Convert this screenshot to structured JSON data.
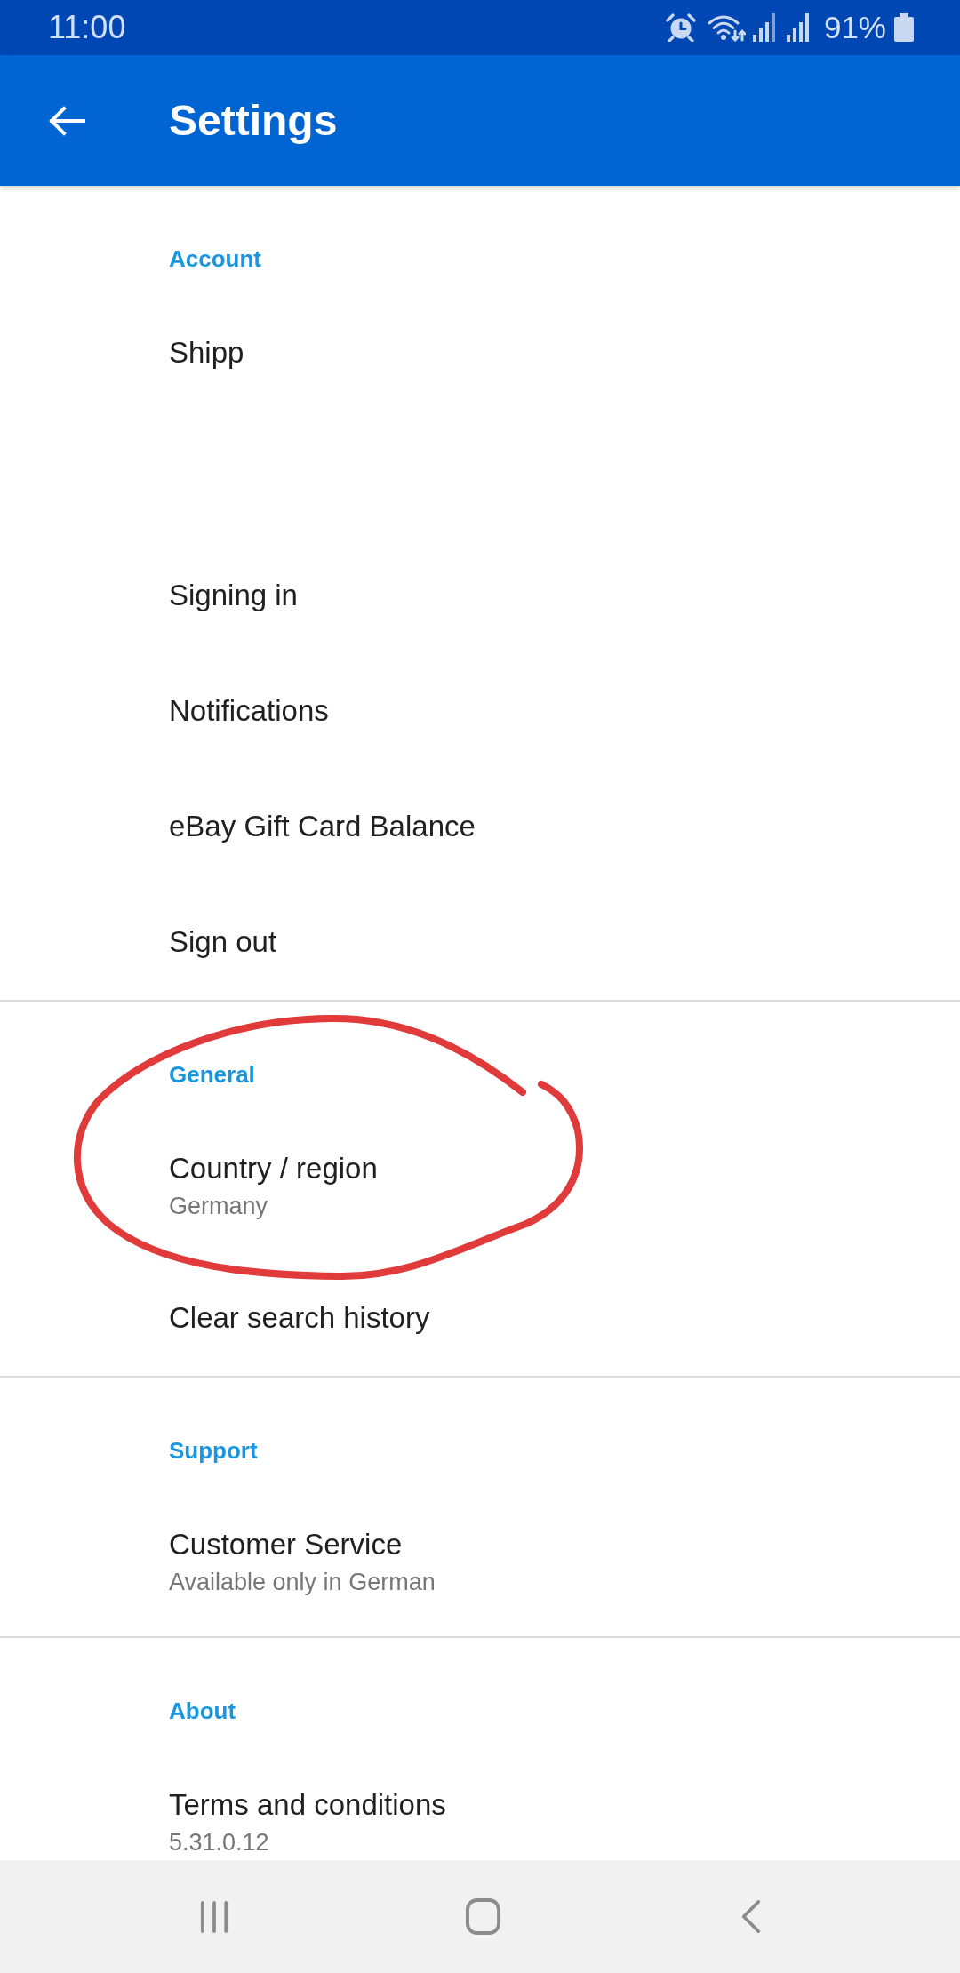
{
  "status_bar": {
    "time": "11:00",
    "battery_percent": "91%"
  },
  "app_bar": {
    "title": "Settings"
  },
  "sections": [
    {
      "header": "Account",
      "circled": false,
      "items": [
        {
          "kind": "redacted",
          "title": "Shipp"
        },
        {
          "kind": "text",
          "title": "Signing in"
        },
        {
          "kind": "text",
          "title": "Notifications"
        },
        {
          "kind": "text",
          "title": "eBay Gift Card Balance"
        },
        {
          "kind": "text",
          "title": "Sign out"
        }
      ]
    },
    {
      "header": "General",
      "circled": true,
      "items": [
        {
          "kind": "text",
          "title": "Country / region",
          "subtitle": "Germany"
        },
        {
          "kind": "text",
          "title": "Clear search history"
        }
      ]
    },
    {
      "header": "Support",
      "circled": false,
      "items": [
        {
          "kind": "text",
          "title": "Customer Service",
          "subtitle": "Available only in German"
        }
      ]
    },
    {
      "header": "About",
      "circled": false,
      "items": [
        {
          "kind": "text",
          "title": "Terms and conditions",
          "subtitle": "5.31.0.12"
        }
      ]
    }
  ]
}
